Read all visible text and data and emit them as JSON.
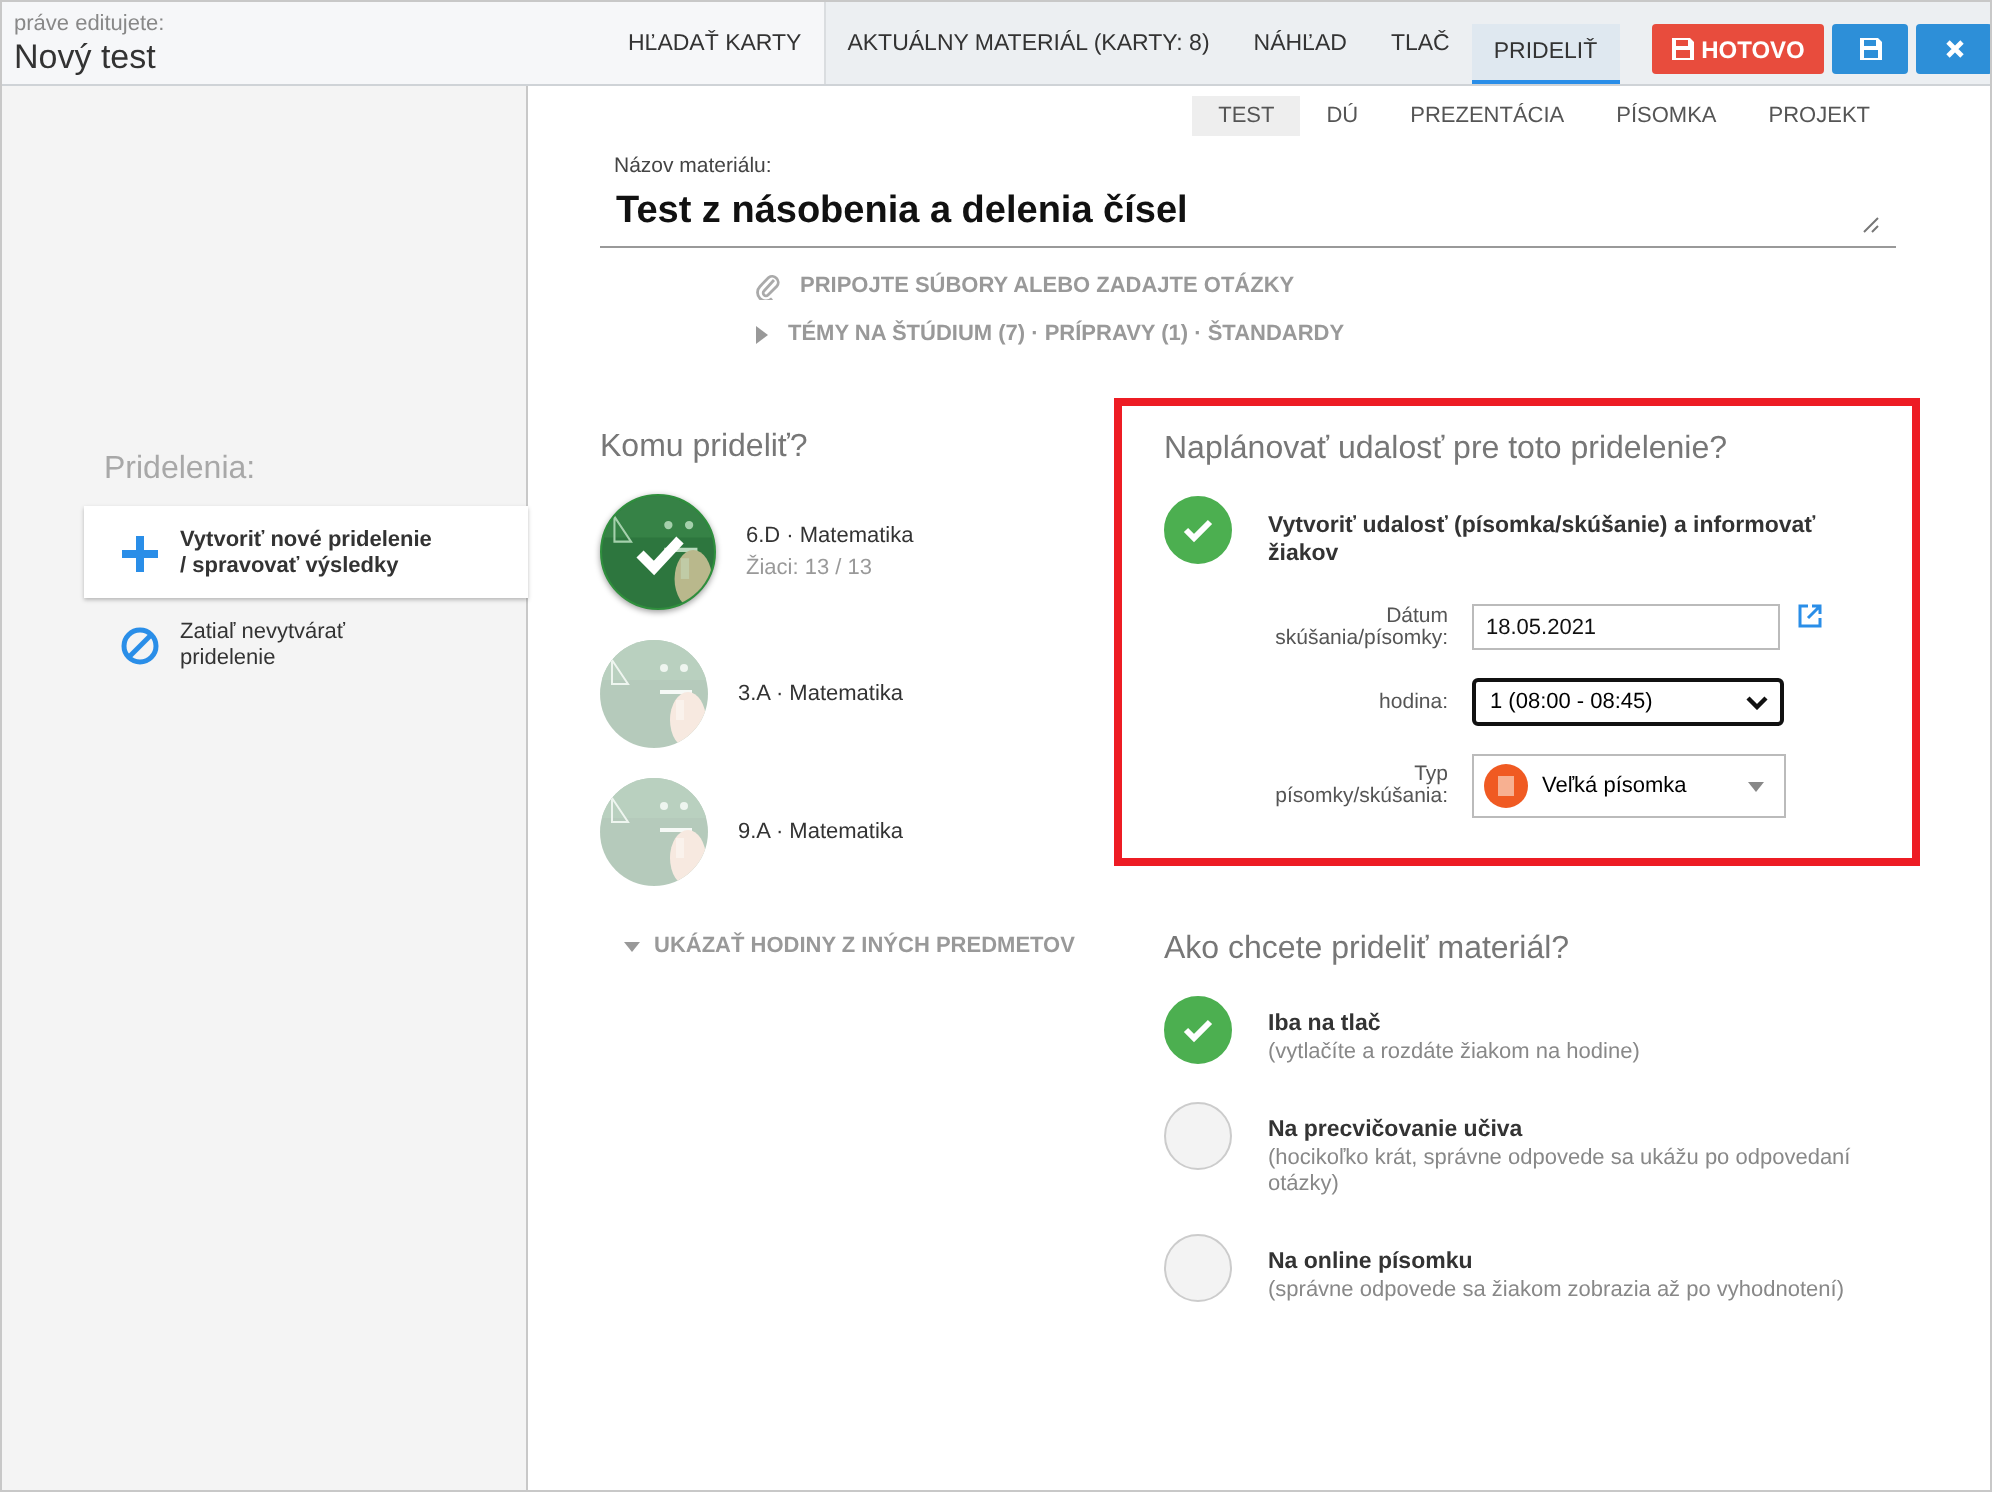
{
  "header": {
    "editing_label": "práve editujete:",
    "title": "Nový test"
  },
  "tabs": [
    {
      "label": "HĽADAŤ KARTY",
      "selected": false
    },
    {
      "label": "AKTUÁLNY MATERIÁL (KARTY: 8)",
      "selected": false
    },
    {
      "label": "NÁHĽAD",
      "selected": false
    },
    {
      "label": "TLAČ",
      "selected": false
    },
    {
      "label": "PRIDELIŤ",
      "selected": true
    }
  ],
  "actions": [
    {
      "kind": "done",
      "label": "HOTOVO"
    },
    {
      "kind": "save"
    },
    {
      "kind": "close"
    }
  ],
  "material_types": [
    {
      "label": "TEST",
      "selected": true
    },
    {
      "label": "DÚ",
      "selected": false
    },
    {
      "label": "PREZENTÁCIA",
      "selected": false
    },
    {
      "label": "PÍSOMKA",
      "selected": false
    },
    {
      "label": "PROJEKT",
      "selected": false
    }
  ],
  "material_name": {
    "label": "Názov materiálu:",
    "value": "Test z násobenia a delenia čísel"
  },
  "links": [
    {
      "kind": "attach",
      "label": "PRIPOJTE SÚBORY ALEBO ZADAJTE OTÁZKY"
    },
    {
      "kind": "expand",
      "label": "TÉMY NA ŠTÚDIUM (7) · PRÍPRAVY (1) · ŠTANDARDY"
    }
  ],
  "sidebar": {
    "title": "Pridelenia:",
    "items": [
      {
        "kind": "create",
        "label": "Vytvoriť nové pridelenie / spravovať výsledky",
        "selected": true
      },
      {
        "kind": "none",
        "label": "Zatiaľ nevytvárať pridelenie",
        "selected": false
      }
    ]
  },
  "recipients": {
    "title": "Komu prideliť?",
    "classes": [
      {
        "name": "6.D · Matematika",
        "students": "Žiaci: 13 / 13",
        "selected": true
      },
      {
        "name": "3.A · Matematika",
        "selected": false
      },
      {
        "name": "9.A · Matematika",
        "selected": false
      }
    ],
    "more_link": "UKÁZAŤ HODINY Z INÝCH PREDMETOV"
  },
  "schedule": {
    "highlighted": true,
    "title": "Naplánovať udalosť pre toto pridelenie?",
    "create_event": {
      "label": "Vytvoriť udalosť (písomka/skúšanie) a informovať žiakov",
      "checked": true
    },
    "date": {
      "label": "Dátum skúšania/písomky:",
      "value": "18.05.2021"
    },
    "period": {
      "label": "hodina:",
      "value": "1 (08:00 - 08:45)"
    },
    "type": {
      "label": "Typ písomky/skúšania:",
      "value": "Veľká písomka"
    }
  },
  "delivery": {
    "title": "Ako chcete prideliť materiál?",
    "options": [
      {
        "title": "Iba na tlač",
        "note": "(vytlačíte a rozdáte žiakom na hodine)",
        "selected": true
      },
      {
        "title": "Na precvičovanie učiva",
        "note": "(hocikoľko krát, správne odpovede sa ukážu po odpovedaní otázky)",
        "selected": false
      },
      {
        "title": "Na online písomku",
        "note": "(správne odpovede sa žiakom zobrazia až po vyhodnotení)",
        "selected": false
      }
    ]
  }
}
